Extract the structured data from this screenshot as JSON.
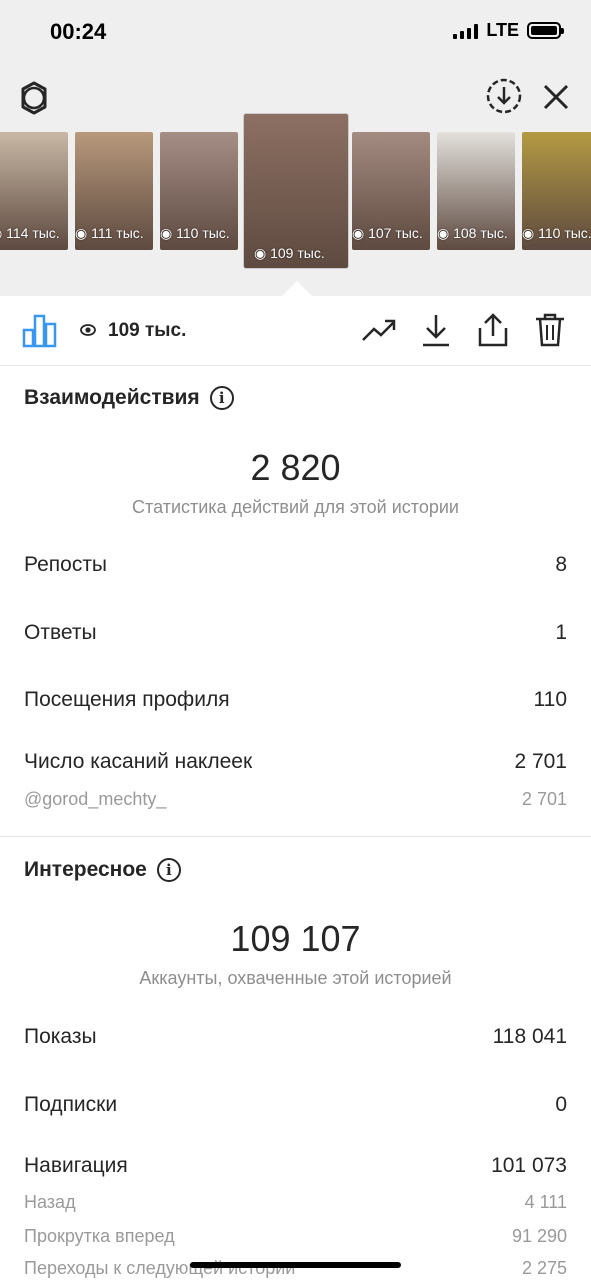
{
  "status_bar": {
    "time": "00:24",
    "network": "LTE"
  },
  "thumbnails": [
    {
      "views": "114 тыс.",
      "color": "#c9b8a6"
    },
    {
      "views": "111 тыс.",
      "color": "#b8997c"
    },
    {
      "views": "110 тыс.",
      "color": "#a58e86"
    },
    {
      "views": "109 тыс.",
      "color": "#8d7063",
      "active": true
    },
    {
      "views": "107 тыс.",
      "color": "#a48b82"
    },
    {
      "views": "108 тыс.",
      "color": "#e3e1dc"
    },
    {
      "views": "110 тыс.",
      "color": "#b49a42"
    }
  ],
  "toolbar": {
    "views": "109 тыс."
  },
  "interactions": {
    "title": "Взаимодействия",
    "total": "2 820",
    "caption": "Статистика действий для этой истории",
    "rows": [
      {
        "label": "Репосты",
        "value": "8"
      },
      {
        "label": "Ответы",
        "value": "1"
      },
      {
        "label": "Посещения профиля",
        "value": "110"
      },
      {
        "label": "Число касаний наклеек",
        "value": "2 701"
      }
    ],
    "sub_row": {
      "label": "@gorod_mechty_",
      "value": "2 701"
    }
  },
  "discovery": {
    "title": "Интересное",
    "total": "109 107",
    "caption": "Аккаунты, охваченные этой историей",
    "rows": [
      {
        "label": "Показы",
        "value": "118 041"
      },
      {
        "label": "Подписки",
        "value": "0"
      },
      {
        "label": "Навигация",
        "value": "101 073"
      }
    ],
    "nav_rows": [
      {
        "label": "Назад",
        "value": "4 111"
      },
      {
        "label": "Прокрутка вперед",
        "value": "91 290"
      },
      {
        "label": "Переходы к следующей истории",
        "value": "2 275"
      }
    ]
  },
  "colors": {
    "accent": "#3897f0",
    "text": "#262626",
    "muted": "#8e8e8e",
    "background_top": "#efefef"
  }
}
